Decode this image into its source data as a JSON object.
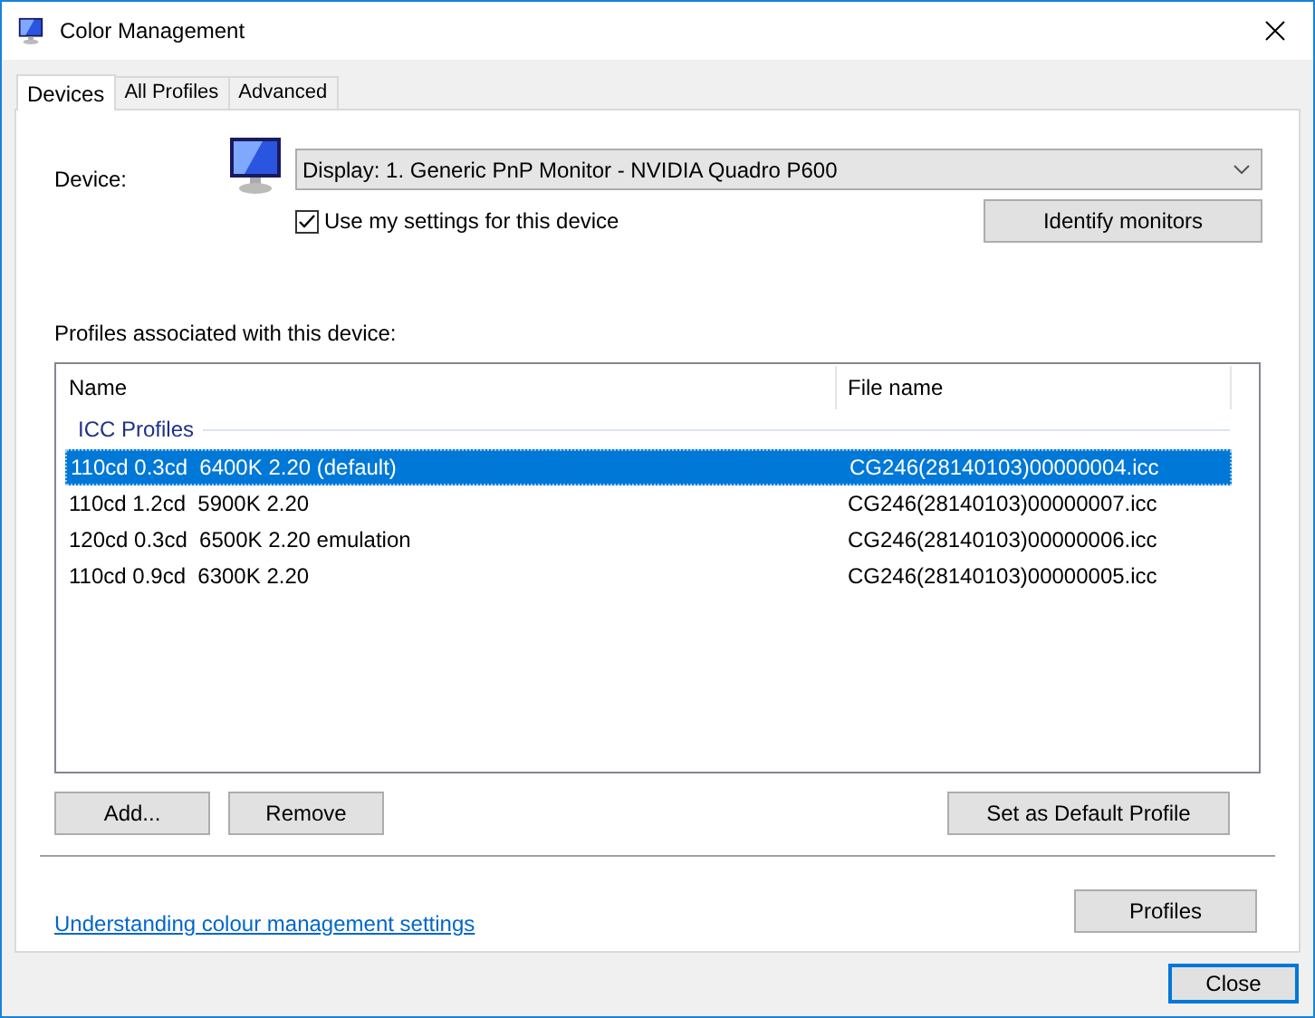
{
  "window": {
    "title": "Color Management"
  },
  "tabs": [
    {
      "label": "Devices",
      "selected": true
    },
    {
      "label": "All Profiles",
      "selected": false
    },
    {
      "label": "Advanced",
      "selected": false
    }
  ],
  "device": {
    "label": "Device:",
    "value": "Display: 1. Generic PnP Monitor - NVIDIA Quadro P600"
  },
  "use_my_settings": {
    "label": "Use my settings for this device",
    "checked": true
  },
  "identify_button": "Identify monitors",
  "profiles_label": "Profiles associated with this device:",
  "table": {
    "columns": [
      "Name",
      "File name"
    ],
    "group": "ICC Profiles",
    "rows": [
      {
        "name": "110cd 0.3cd  6400K 2.20 (default)",
        "file": "CG246(28140103)00000004.icc",
        "selected": true
      },
      {
        "name": "110cd 1.2cd  5900K 2.20",
        "file": "CG246(28140103)00000007.icc",
        "selected": false
      },
      {
        "name": "120cd 0.3cd  6500K 2.20 emulation",
        "file": "CG246(28140103)00000006.icc",
        "selected": false
      },
      {
        "name": "110cd 0.9cd  6300K 2.20",
        "file": "CG246(28140103)00000005.icc",
        "selected": false
      }
    ]
  },
  "list_buttons": [
    "Add...",
    "Remove",
    "Set as Default Profile"
  ],
  "link": "Understanding colour management settings",
  "profiles_button": "Profiles",
  "close_button": "Close"
}
